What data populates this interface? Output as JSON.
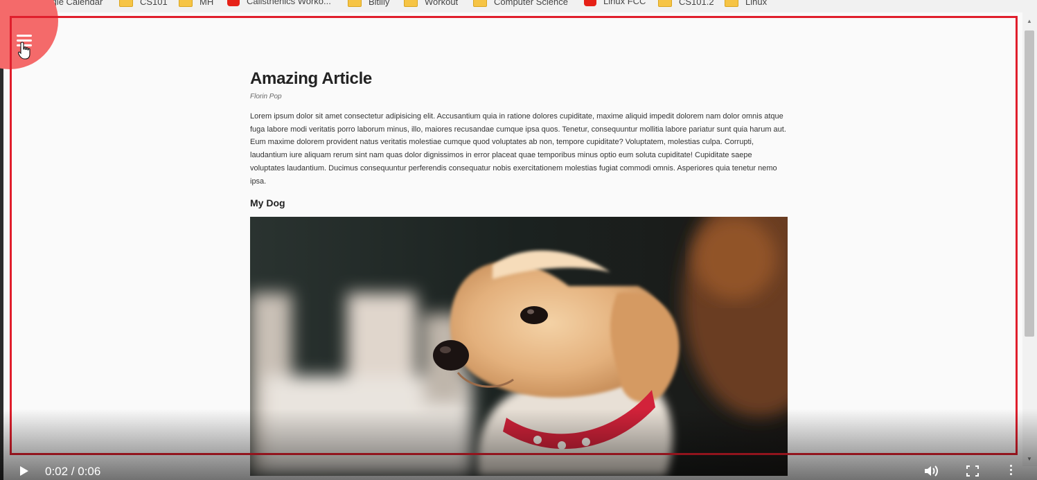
{
  "bookmarks": [
    {
      "label": "Google Calendar",
      "icon": "calendar-icon"
    },
    {
      "label": "CS101",
      "icon": "folder-icon"
    },
    {
      "label": "MH",
      "icon": "folder-icon"
    },
    {
      "label": "Calisthenics Worko...",
      "icon": "youtube-icon"
    },
    {
      "label": "Bitilly",
      "icon": "folder-icon"
    },
    {
      "label": "Workout",
      "icon": "folder-icon"
    },
    {
      "label": "Computer Science",
      "icon": "folder-icon"
    },
    {
      "label": "Linux FCC",
      "icon": "youtube-icon"
    },
    {
      "label": "CS101.2",
      "icon": "folder-icon"
    },
    {
      "label": "Linux",
      "icon": "folder-icon"
    }
  ],
  "article": {
    "title": "Amazing Article",
    "author": "Florin Pop",
    "body": "Lorem ipsum dolor sit amet consectetur adipisicing elit. Accusantium quia in ratione dolores cupiditate, maxime aliquid impedit dolorem nam dolor omnis atque fuga labore modi veritatis porro laborum minus, illo, maiores recusandae cumque ipsa quos. Tenetur, consequuntur mollitia labore pariatur sunt quia harum aut. Eum maxime dolorem provident natus veritatis molestiae cumque quod voluptates ab non, tempore cupiditate? Voluptatem, molestias culpa. Corrupti, laudantium iure aliquam rerum sint nam quas dolor dignissimos in error placeat quae temporibus minus optio eum soluta cupiditate! Cupiditate saepe voluptates laudantium. Ducimus consequuntur perferendis consequatur nobis exercitationem molestias fugiat commodi omnis. Asperiores quia tenetur nemo ipsa.",
    "subheading": "My Dog",
    "image": "puppy-photo"
  },
  "video": {
    "time": "0:02 / 0:06"
  },
  "colors": {
    "nav_circle": "#f46a6a",
    "highlight_border": "#e01e2c",
    "page_bg": "#fafafa"
  }
}
